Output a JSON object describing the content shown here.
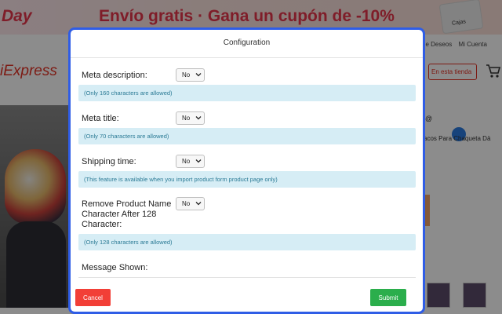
{
  "background": {
    "promo": {
      "day_label": "Day",
      "banner_text": "Envío gratis  · Gana un cupón de -10%",
      "box_label": "Cajas"
    },
    "header": {
      "links": [
        "de Deseos",
        "Mi Cuenta"
      ],
      "logo": "iExpress",
      "store_button": "En esta tienda"
    },
    "product": {
      "side_info": "@",
      "side_desc": "acos Para Chaqueta Dä"
    }
  },
  "modal": {
    "title": "Configuration",
    "fields": [
      {
        "label": "Meta description:",
        "value": "No",
        "note": "(Only 160 characters are allowed)"
      },
      {
        "label": "Meta title:",
        "value": "No",
        "note": "(Only 70 characters are allowed)"
      },
      {
        "label": "Shipping time:",
        "value": "No",
        "note": "(This feature is available when you import product form product page only)"
      },
      {
        "label": "Remove Product Name Character After 128 Character:",
        "value": "No",
        "note": "(Only 128 characters are allowed)"
      },
      {
        "label": "Message Shown:"
      }
    ],
    "cancel_label": "Cancel",
    "submit_label": "Submit"
  },
  "colors": {
    "modal_border": "#2f5de6",
    "note_bg": "#d6edf5",
    "cancel": "#f23f37",
    "submit": "#2bae4c",
    "brand": "#e43225"
  }
}
